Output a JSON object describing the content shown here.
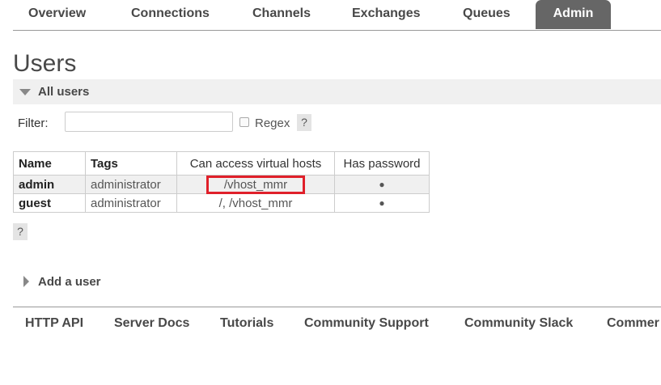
{
  "nav": {
    "items": [
      {
        "label": "Overview"
      },
      {
        "label": "Connections"
      },
      {
        "label": "Channels"
      },
      {
        "label": "Exchanges"
      },
      {
        "label": "Queues"
      },
      {
        "label": "Admin",
        "active": true
      }
    ]
  },
  "page": {
    "title": "Users"
  },
  "all_users": {
    "label": "All users"
  },
  "filter": {
    "label": "Filter:",
    "value": "",
    "regex_label": "Regex",
    "regex_checked": false,
    "help": "?"
  },
  "table": {
    "headers": [
      "Name",
      "Tags",
      "Can access virtual hosts",
      "Has password"
    ],
    "rows": [
      {
        "name": "admin",
        "tags": "administrator",
        "vhosts": "/vhost_mmr",
        "has_password": "●"
      },
      {
        "name": "guest",
        "tags": "administrator",
        "vhosts": "/, /vhost_mmr",
        "has_password": "●"
      }
    ],
    "help": "?"
  },
  "add_user": {
    "label": "Add a user"
  },
  "footer": {
    "links": [
      "HTTP API",
      "Server Docs",
      "Tutorials",
      "Community Support",
      "Community Slack",
      "Commer"
    ]
  },
  "colors": {
    "active_tab": "#666666",
    "highlight": "#e0202a",
    "section_bg": "#f0f0f0"
  }
}
